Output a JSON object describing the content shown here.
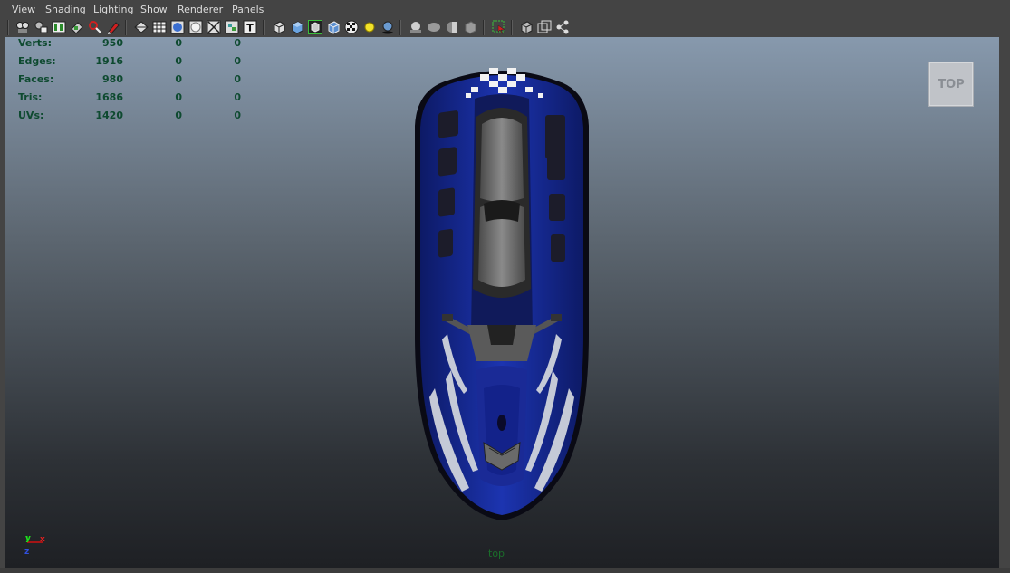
{
  "menu": {
    "items": [
      "View",
      "Shading",
      "Lighting",
      "Show",
      "Renderer",
      "Panels"
    ]
  },
  "toolbar": {
    "icons": [
      "select-camera-icon",
      "camera-attributes-icon",
      "bookmark-icon",
      "image-plane-icon",
      "2d-pan-zoom-icon",
      "grease-pencil-icon",
      "wireframe-icon",
      "smooth-shade-icon",
      "default-material-icon",
      "bounding-box-icon",
      "isolate-select-icon",
      "xray-icon",
      "texture-icon",
      "resolution-gate-icon",
      "flat-shade-icon",
      "smooth-shade-all-icon",
      "wireframe-on-shaded-icon",
      "textured-icon",
      "use-all-lights-icon",
      "shadows-icon",
      "high-quality-icon",
      "screen-space-ao-icon",
      "motion-blur-icon",
      "multisample-aa-icon",
      "depth-of-field-icon",
      "isolate-icon",
      "camera-cube-icon",
      "gate-mask-icon",
      "film-gate-icon"
    ]
  },
  "hud": {
    "rows": [
      {
        "label": "Verts:",
        "values": [
          "950",
          "0",
          "0"
        ]
      },
      {
        "label": "Edges:",
        "values": [
          "1916",
          "0",
          "0"
        ]
      },
      {
        "label": "Faces:",
        "values": [
          "980",
          "0",
          "0"
        ]
      },
      {
        "label": "Tris:",
        "values": [
          "1686",
          "0",
          "0"
        ]
      },
      {
        "label": "UVs:",
        "values": [
          "1420",
          "0",
          "0"
        ]
      }
    ]
  },
  "viewcube": {
    "label": "TOP"
  },
  "camera": {
    "name": "top"
  },
  "axis": {
    "y": "y",
    "x": "x",
    "z": "z"
  },
  "colors": {
    "hud_text": "#0e4a30",
    "hull_blue": "#1c2f9e",
    "seat_gray": "#6b6b6b",
    "axis_red": "#d01010",
    "axis_green": "#10b010",
    "axis_blue": "#2040d0"
  }
}
